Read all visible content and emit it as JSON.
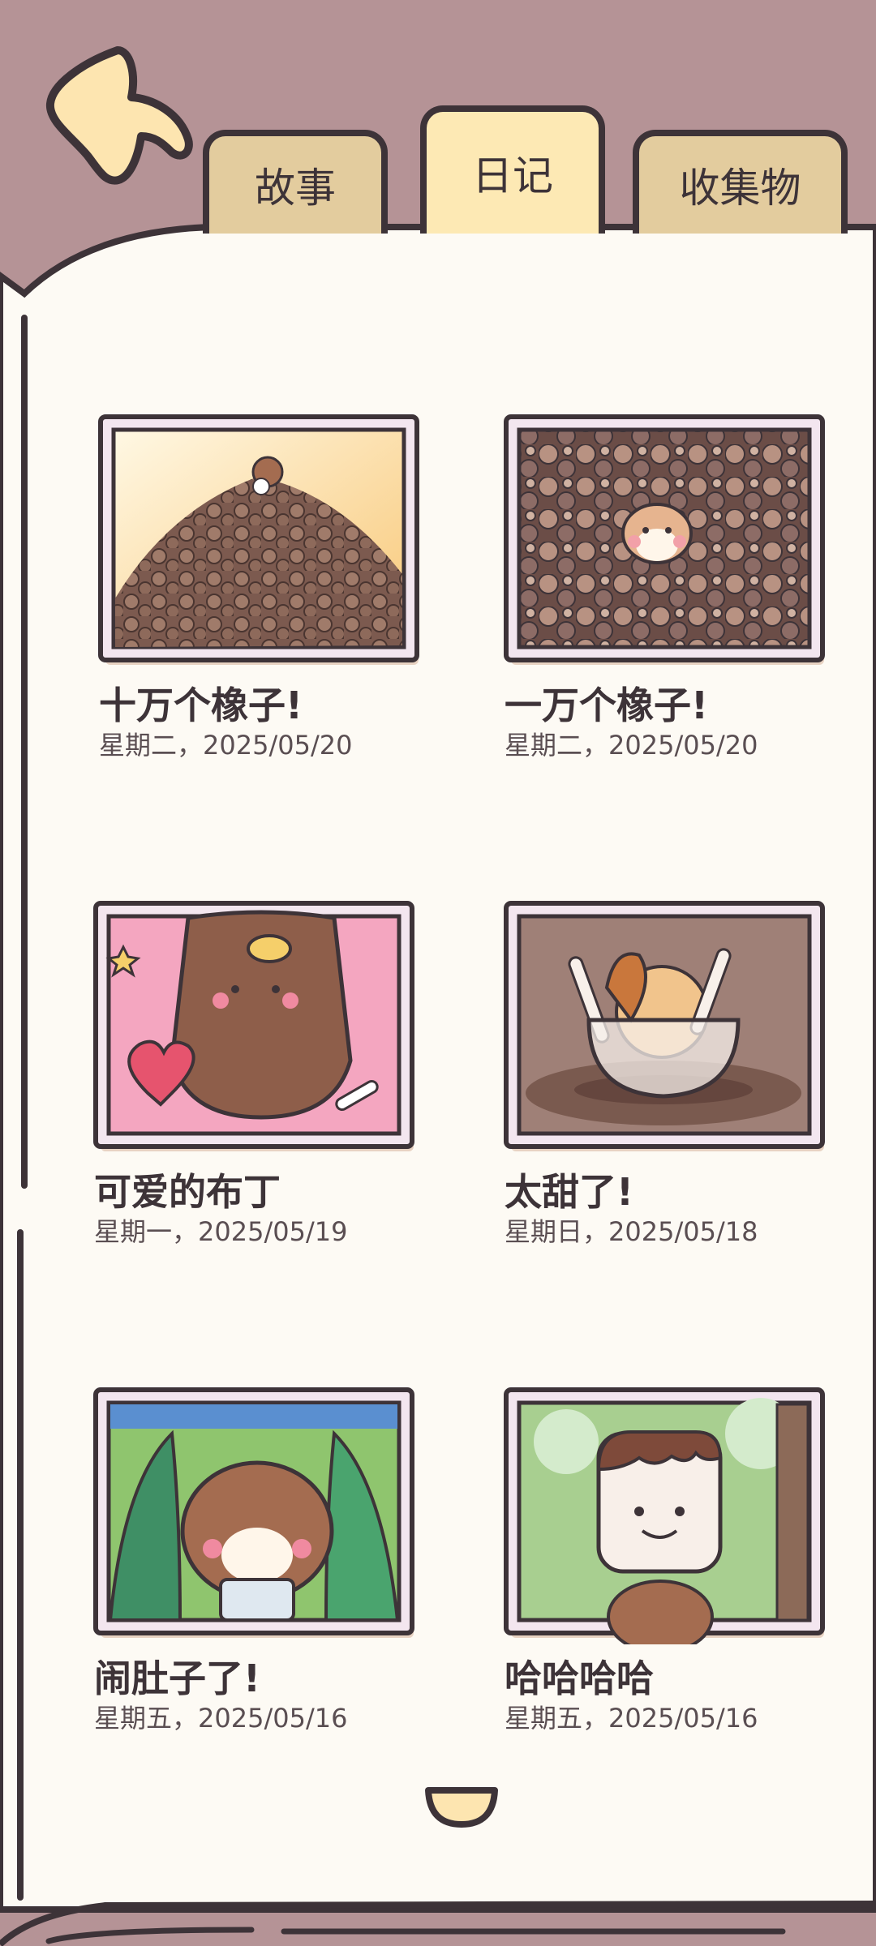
{
  "tabs": [
    {
      "label": "故事"
    },
    {
      "label": "日记"
    },
    {
      "label": "收集物"
    }
  ],
  "diary_entries": [
    {
      "title": "十万个橡子!",
      "date": "星期二，2025/05/20",
      "image": "acorn-mountain-photo"
    },
    {
      "title": "一万个橡子!",
      "date": "星期二，2025/05/20",
      "image": "acorn-pile-squirrel-photo"
    },
    {
      "title": "可爱的布丁",
      "date": "星期一，2025/05/19",
      "image": "puppy-pudding-photo"
    },
    {
      "title": "太甜了!",
      "date": "星期日，2025/05/18",
      "image": "ice-cream-cup-photo"
    },
    {
      "title": "闹肚子了!",
      "date": "星期五，2025/05/16",
      "image": "squirrel-toilet-paper-photo"
    },
    {
      "title": "哈哈哈哈",
      "date": "星期五，2025/05/16",
      "image": "popsicle-photo"
    }
  ],
  "colors": {
    "header_bg": "#b59396",
    "page_bg": "#fdfaf4",
    "outline": "#3d3338",
    "tab": "#e3cc9e",
    "tab_active": "#fde9b4"
  }
}
